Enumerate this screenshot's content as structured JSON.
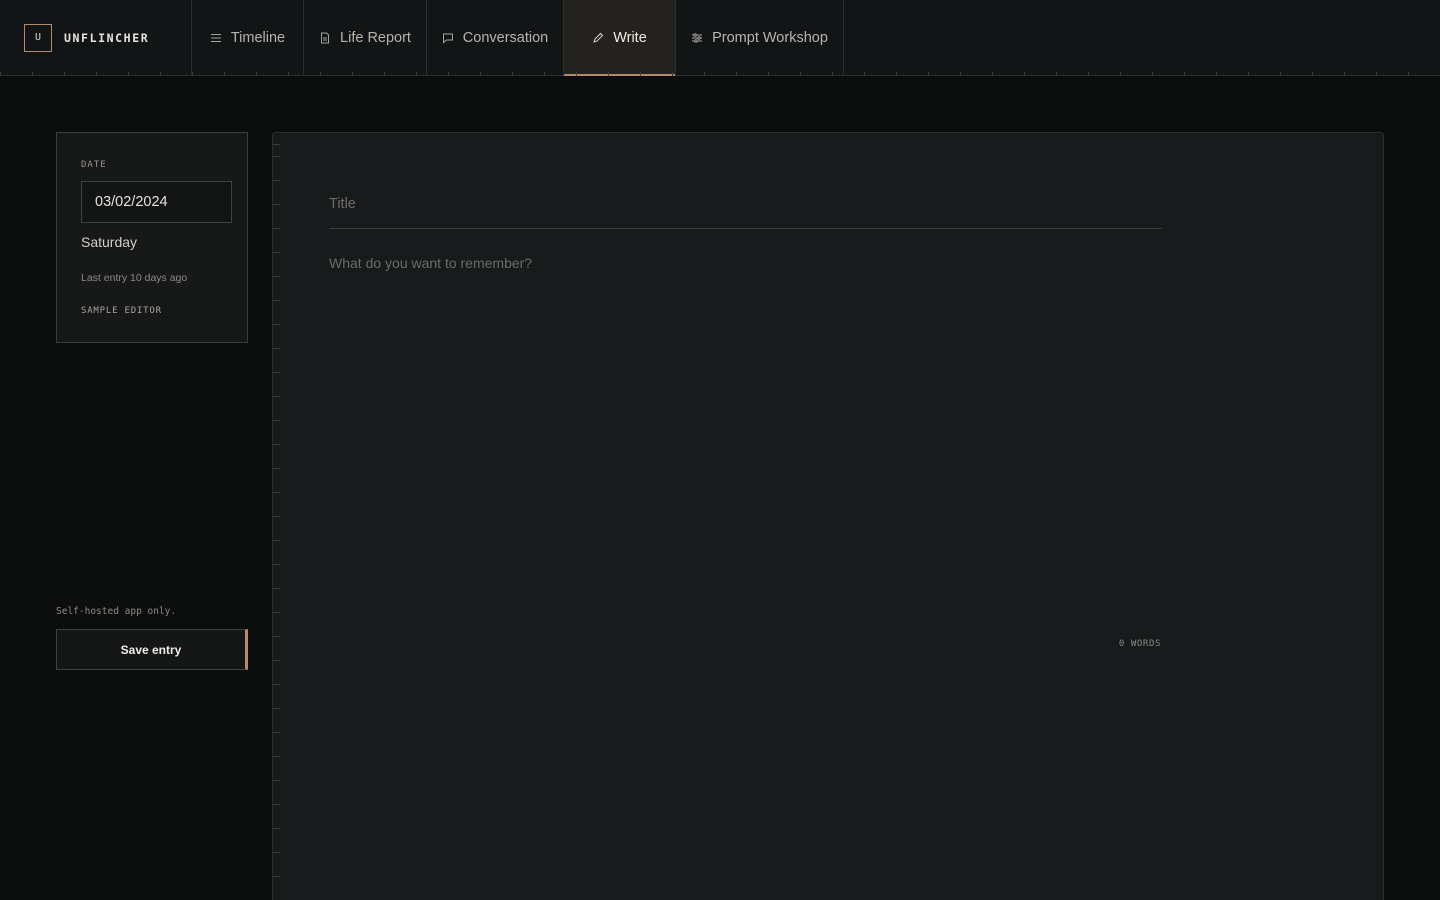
{
  "brand": {
    "mark": "U",
    "name": "UNFLINCHER"
  },
  "nav": {
    "tabs": [
      {
        "label": "Timeline",
        "icon": "list-icon"
      },
      {
        "label": "Life Report",
        "icon": "document-icon"
      },
      {
        "label": "Conversation",
        "icon": "chat-icon"
      },
      {
        "label": "Write",
        "icon": "pencil-icon",
        "active": true
      },
      {
        "label": "Prompt Workshop",
        "icon": "sliders-icon"
      }
    ]
  },
  "sidebar": {
    "date_label": "DATE",
    "date_value": "03/02/2024",
    "day_name": "Saturday",
    "last_entry": "Last entry 10 days ago",
    "sample_editor": "SAMPLE EDITOR",
    "self_hosted_note": "Self-hosted app only.",
    "save_label": "Save entry"
  },
  "editor": {
    "title_placeholder": "Title",
    "body_placeholder": "What do you want to remember?",
    "word_count": "0 WORDS"
  },
  "colors": {
    "background": "#0c0e0d",
    "panel": "#171b1b",
    "accent": "#b58a6a",
    "text": "#d8d4cc"
  }
}
